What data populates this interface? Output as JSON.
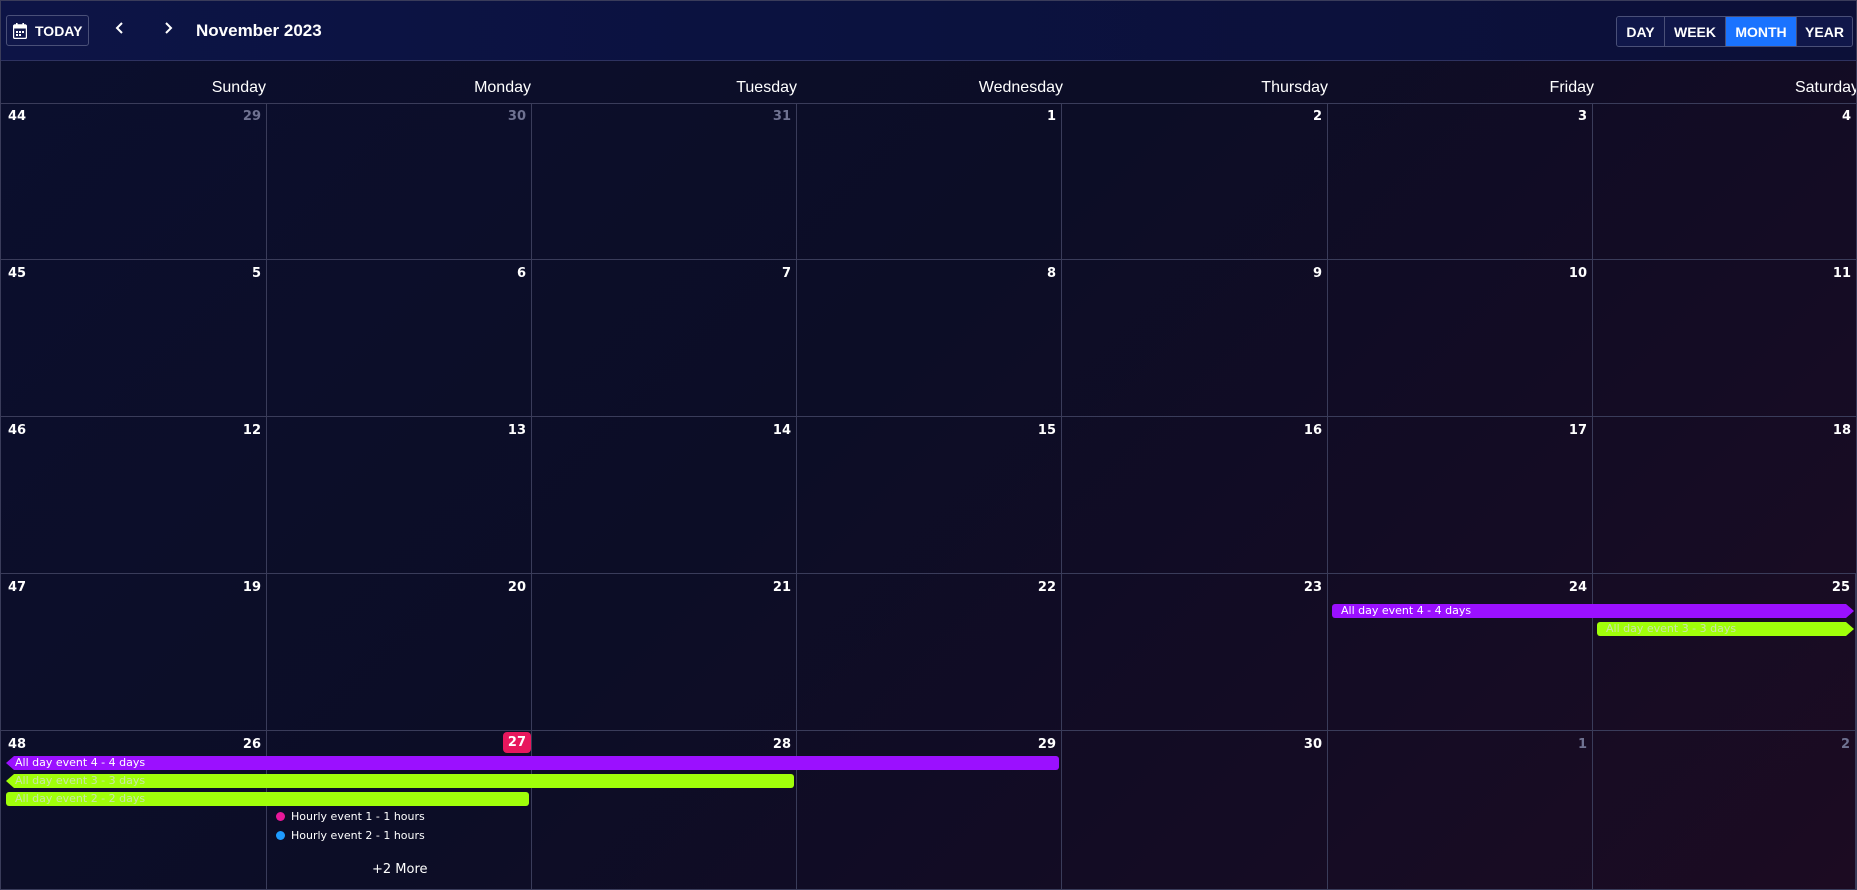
{
  "header": {
    "today_label": "TODAY",
    "title": "November 2023",
    "views": [
      "DAY",
      "WEEK",
      "MONTH",
      "YEAR"
    ],
    "active_view": "MONTH"
  },
  "weekdays": [
    "Sunday",
    "Monday",
    "Tuesday",
    "Wednesday",
    "Thursday",
    "Friday",
    "Saturday"
  ],
  "weeks": [
    {
      "week_number": "44",
      "days": [
        "29",
        "30",
        "31",
        "1",
        "2",
        "3",
        "4"
      ]
    },
    {
      "week_number": "45",
      "days": [
        "5",
        "6",
        "7",
        "8",
        "9",
        "10",
        "11"
      ]
    },
    {
      "week_number": "46",
      "days": [
        "12",
        "13",
        "14",
        "15",
        "16",
        "17",
        "18"
      ]
    },
    {
      "week_number": "47",
      "days": [
        "19",
        "20",
        "21",
        "22",
        "23",
        "24",
        "25"
      ]
    },
    {
      "week_number": "48",
      "days": [
        "26",
        "27",
        "28",
        "29",
        "30",
        "1",
        "2"
      ]
    }
  ],
  "today": "27",
  "events": {
    "all_day_4": "All day event 4 - 4 days",
    "all_day_3": "All day event 3 - 3 days",
    "all_day_2": "All day event 2 - 2 days",
    "hourly_1": "Hourly event 1 - 1 hours",
    "hourly_2": "Hourly event 2 - 1 hours",
    "more_label": "+2 More"
  },
  "colors": {
    "accent": "#1a73ff",
    "today": "#e8175d",
    "event_purple": "#9b10ff",
    "event_green": "#a0ff0a",
    "hourly_1_dot": "#e8179a",
    "hourly_2_dot": "#1e9bff"
  },
  "icons": {
    "today": "calendar-icon",
    "prev": "chevron-left-icon",
    "next": "chevron-right-icon"
  }
}
